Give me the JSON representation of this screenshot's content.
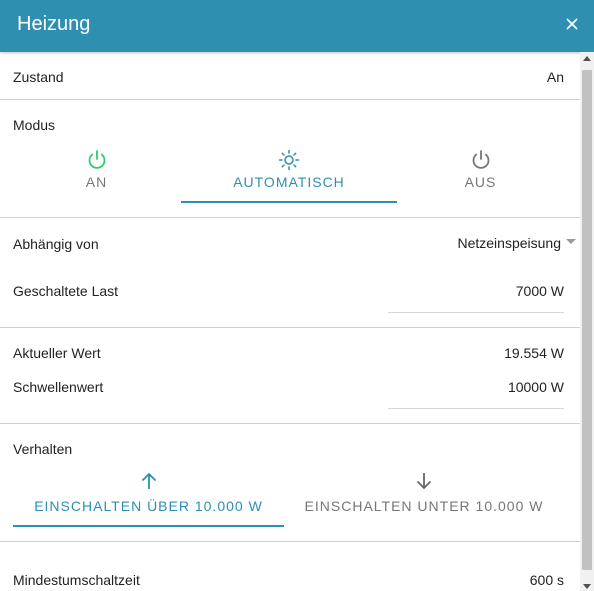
{
  "dialog": {
    "title": "Heizung",
    "close_icon": "close-icon"
  },
  "status": {
    "label": "Zustand",
    "value": "An"
  },
  "mode": {
    "label": "Modus",
    "tabs": [
      {
        "label": "AN",
        "icon": "power-icon",
        "icon_color": "#2ecc71",
        "active": false
      },
      {
        "label": "AUTOMATISCH",
        "icon": "sun-icon",
        "icon_color": "#2e8fb0",
        "active": true
      },
      {
        "label": "AUS",
        "icon": "power-icon",
        "icon_color": "#777777",
        "active": false
      }
    ]
  },
  "dependency": {
    "label": "Abhängig von",
    "value": "Netzeinspeisung"
  },
  "switched_load": {
    "label": "Geschaltete Last",
    "value": "7000 W"
  },
  "current_value": {
    "label": "Aktueller Wert",
    "value": "19.554 W"
  },
  "threshold": {
    "label": "Schwellenwert",
    "value": "10000 W"
  },
  "behavior": {
    "label": "Verhalten",
    "tabs": [
      {
        "label": "EINSCHALTEN ÜBER 10.000 W",
        "icon": "arrow-up-icon",
        "active": true
      },
      {
        "label": "EINSCHALTEN UNTER 10.000 W",
        "icon": "arrow-down-icon",
        "active": false
      }
    ]
  },
  "min_switch_time": {
    "label": "Mindestumschaltzeit",
    "value": "600 s"
  },
  "colors": {
    "accent": "#2e8fb0",
    "on_green": "#2ecc71",
    "muted": "#777777"
  }
}
